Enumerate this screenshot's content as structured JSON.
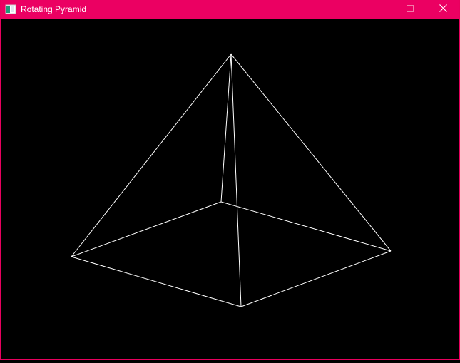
{
  "window": {
    "title": "Rotating Pyramid",
    "titlebar_color": "#eb0062",
    "background_color": "#000000",
    "line_color": "#ffffff"
  },
  "icons": {
    "app": "app-window-icon",
    "minimize": "minimize-icon",
    "maximize": "maximize-icon",
    "close": "close-icon"
  }
}
